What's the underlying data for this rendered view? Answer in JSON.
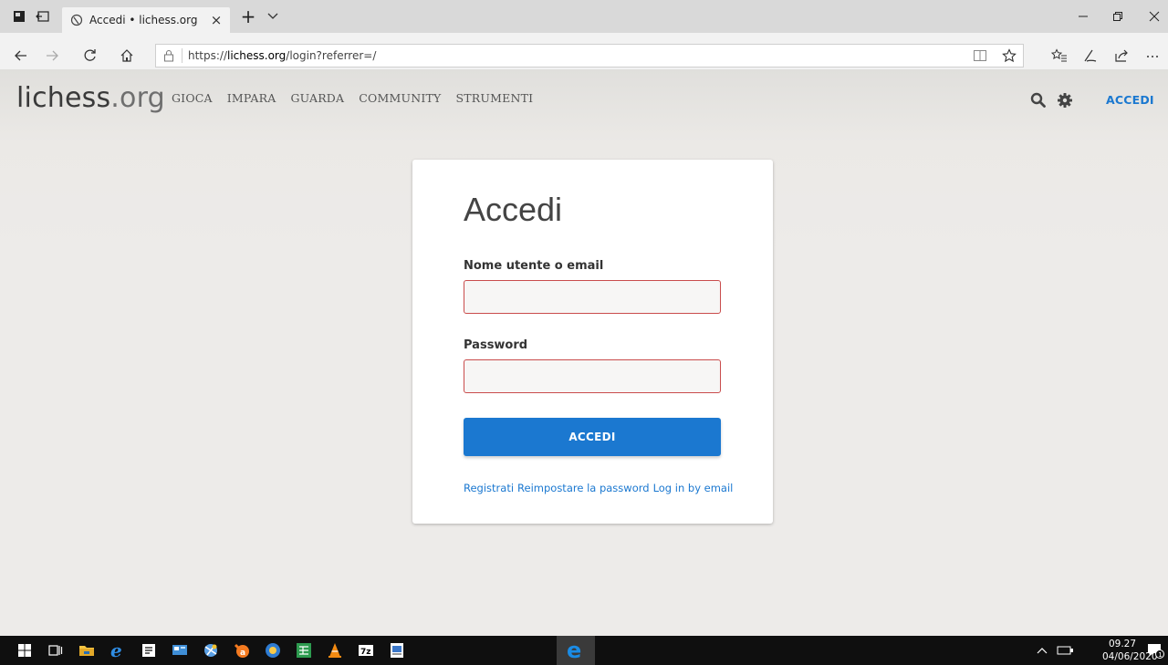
{
  "browser": {
    "tab_title": "Accedi • lichess.org",
    "tab_close": "×",
    "new_tab": "+",
    "url_prefix": "https://",
    "url_domain": "lichess.org",
    "url_path": "/login?referrer=/"
  },
  "site": {
    "logo_name": "lichess",
    "logo_tld": ".org",
    "nav": [
      "GIOCA",
      "IMPARA",
      "GUARDA",
      "COMMUNITY",
      "STRUMENTI"
    ],
    "login_link": "ACCEDI"
  },
  "login": {
    "title": "Accedi",
    "username_label": "Nome utente o email",
    "username_value": "",
    "password_label": "Password",
    "password_value": "",
    "submit_label": "ACCEDI",
    "links": [
      "Registrati",
      "Reimpostare la password",
      "Log in by email"
    ]
  },
  "taskbar": {
    "time": "09.27",
    "date": "04/06/2020",
    "notification_count": "1"
  },
  "colors": {
    "accent": "#1b78d0",
    "field_error_border": "#c94c4c"
  }
}
